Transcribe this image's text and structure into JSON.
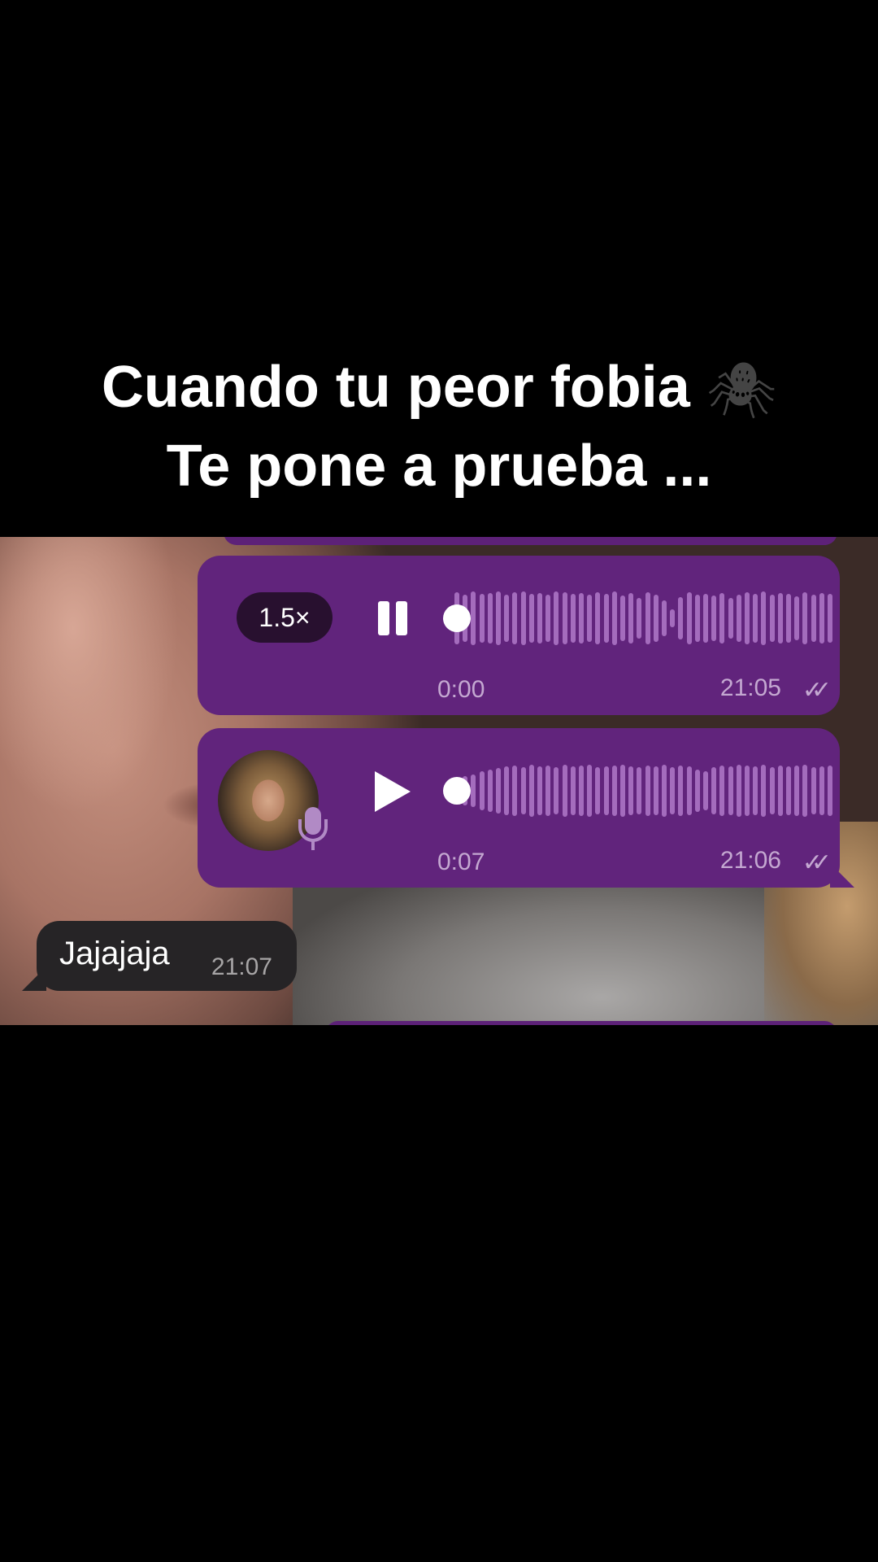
{
  "caption": {
    "line1": "Cuando tu peor fobia",
    "emoji": "🕷",
    "line2": "Te pone a prueba ..."
  },
  "chat": {
    "voice_message_1": {
      "speed": "1.5×",
      "state": "playing",
      "control_icon": "pause-icon",
      "duration": "0:00",
      "time": "21:05",
      "status_icon": "double-check-icon"
    },
    "voice_message_2": {
      "state": "paused",
      "control_icon": "play-icon",
      "duration": "0:07",
      "time": "21:06",
      "status_icon": "double-check-icon"
    },
    "text_message": {
      "text": "Jajajaja",
      "time": "21:07"
    }
  },
  "colors": {
    "bubble_sent": "#61247c",
    "bubble_received": "#262426",
    "waveform": "#a46cbd",
    "meta_text": "#c4a8d1"
  }
}
